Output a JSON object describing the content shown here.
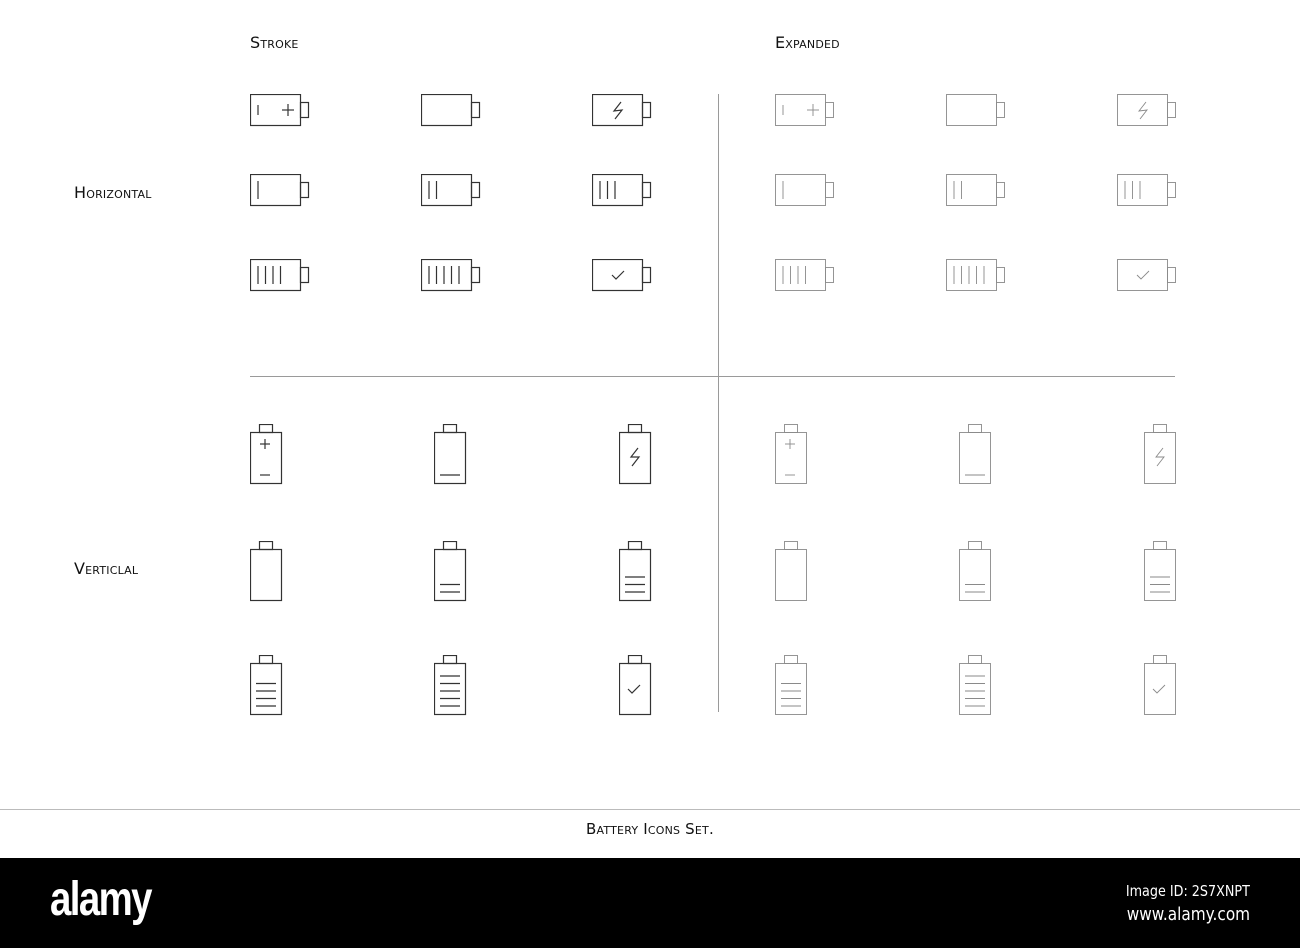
{
  "headers": {
    "stroke": "Stroke",
    "expanded": "Expanded"
  },
  "rows": {
    "horizontal": "Horizontal",
    "vertical": "Verticlal"
  },
  "caption": "Battery Icons Set.",
  "colors": {
    "stroke": "#333333",
    "expanded": "#8a8a8a"
  },
  "icons": {
    "horizontal": [
      "plus-minus",
      "empty",
      "charging",
      "level-1",
      "level-2",
      "level-3",
      "level-4",
      "level-5",
      "check"
    ],
    "vertical": [
      "plus-minus",
      "level-1",
      "charging",
      "empty",
      "level-2",
      "level-3",
      "level-4",
      "level-5",
      "check"
    ]
  },
  "footer": {
    "logo": "alamy",
    "image_id": "Image ID: 2S7XNPT",
    "site": "www.alamy.com"
  }
}
